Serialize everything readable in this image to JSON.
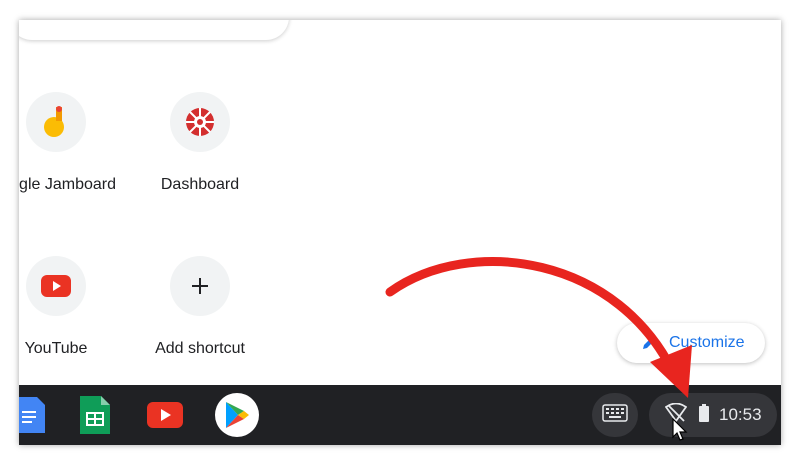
{
  "shortcuts": [
    {
      "label": "Google Jamboard",
      "icon": "jamboard-icon"
    },
    {
      "label": "Dashboard",
      "icon": "dashboard-logo-icon"
    },
    {
      "label": "YouTube",
      "icon": "youtube-icon"
    },
    {
      "label": "Add shortcut",
      "icon": "plus-icon"
    }
  ],
  "customize": {
    "label": "Customize",
    "icon": "pencil-icon"
  },
  "shelf": {
    "apps": [
      {
        "icon": "google-docs-icon"
      },
      {
        "icon": "google-sheets-icon"
      },
      {
        "icon": "youtube-icon"
      },
      {
        "icon": "google-play-icon"
      }
    ],
    "keyboard_icon": "keyboard-icon",
    "status": {
      "network_icon": "wifi-off-icon",
      "battery_icon": "battery-icon",
      "time": "10:53"
    }
  },
  "colors": {
    "shelf": "#202124",
    "accent": "#1a73e8",
    "arrow": "#e8251f",
    "youtube": "#ea3323"
  }
}
